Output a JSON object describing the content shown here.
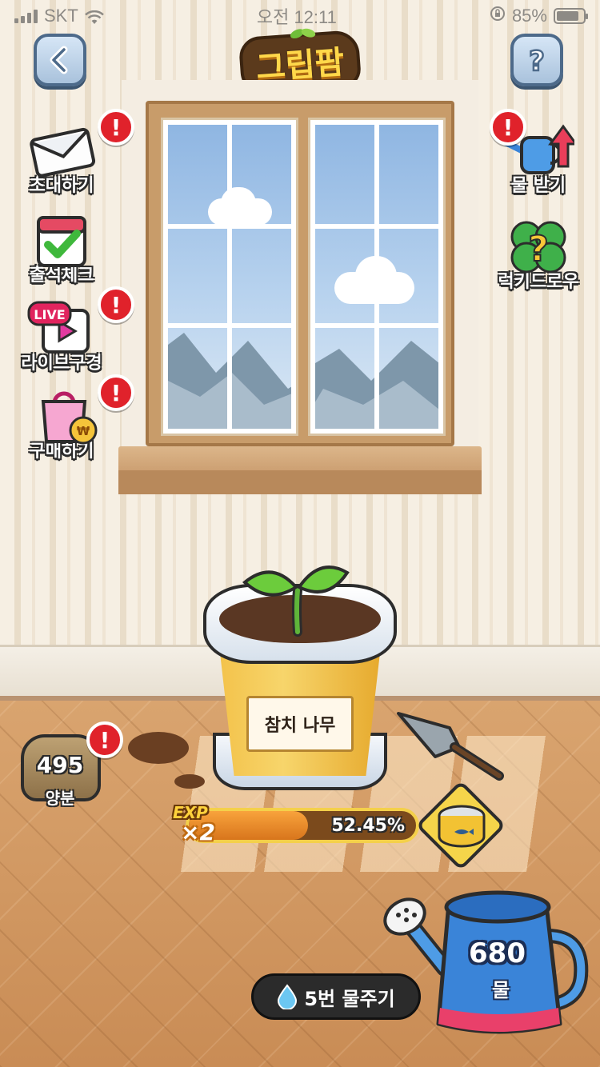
{
  "status_bar": {
    "carrier": "SKT",
    "time": "오전 12:11",
    "battery": "85%",
    "battery_level": 0.85
  },
  "header": {
    "logo": "그립팜"
  },
  "left_menu": [
    {
      "label": "초대하기",
      "icon": "envelope-icon",
      "alert": "!"
    },
    {
      "label": "출석체크",
      "icon": "calendar-check-icon",
      "alert": ""
    },
    {
      "label": "라이브구경",
      "icon": "live-play-icon",
      "alert": "!"
    },
    {
      "label": "구매하기",
      "icon": "shopping-bag-icon",
      "alert": "!"
    }
  ],
  "right_menu": [
    {
      "label": "물 받기",
      "icon": "watering-can-arrow-icon",
      "alert": "!"
    },
    {
      "label": "럭키드로우",
      "icon": "lucky-clover-icon",
      "alert": ""
    }
  ],
  "live_tag": "LIVE",
  "pot": {
    "name": "참치 나무"
  },
  "nutrient": {
    "count": "495",
    "label": "양분",
    "alert": "!"
  },
  "exp": {
    "multiplier_top": "EXP",
    "multiplier": "×2",
    "percent_text": "52.45%",
    "progress": 0.5245
  },
  "water_button": {
    "label": "5번 물주기"
  },
  "watering_can": {
    "count": "680",
    "label": "물"
  },
  "colors": {
    "alert_red": "#e0222b",
    "exp_orange": "#f0912e",
    "can_blue": "#3a84d8"
  }
}
